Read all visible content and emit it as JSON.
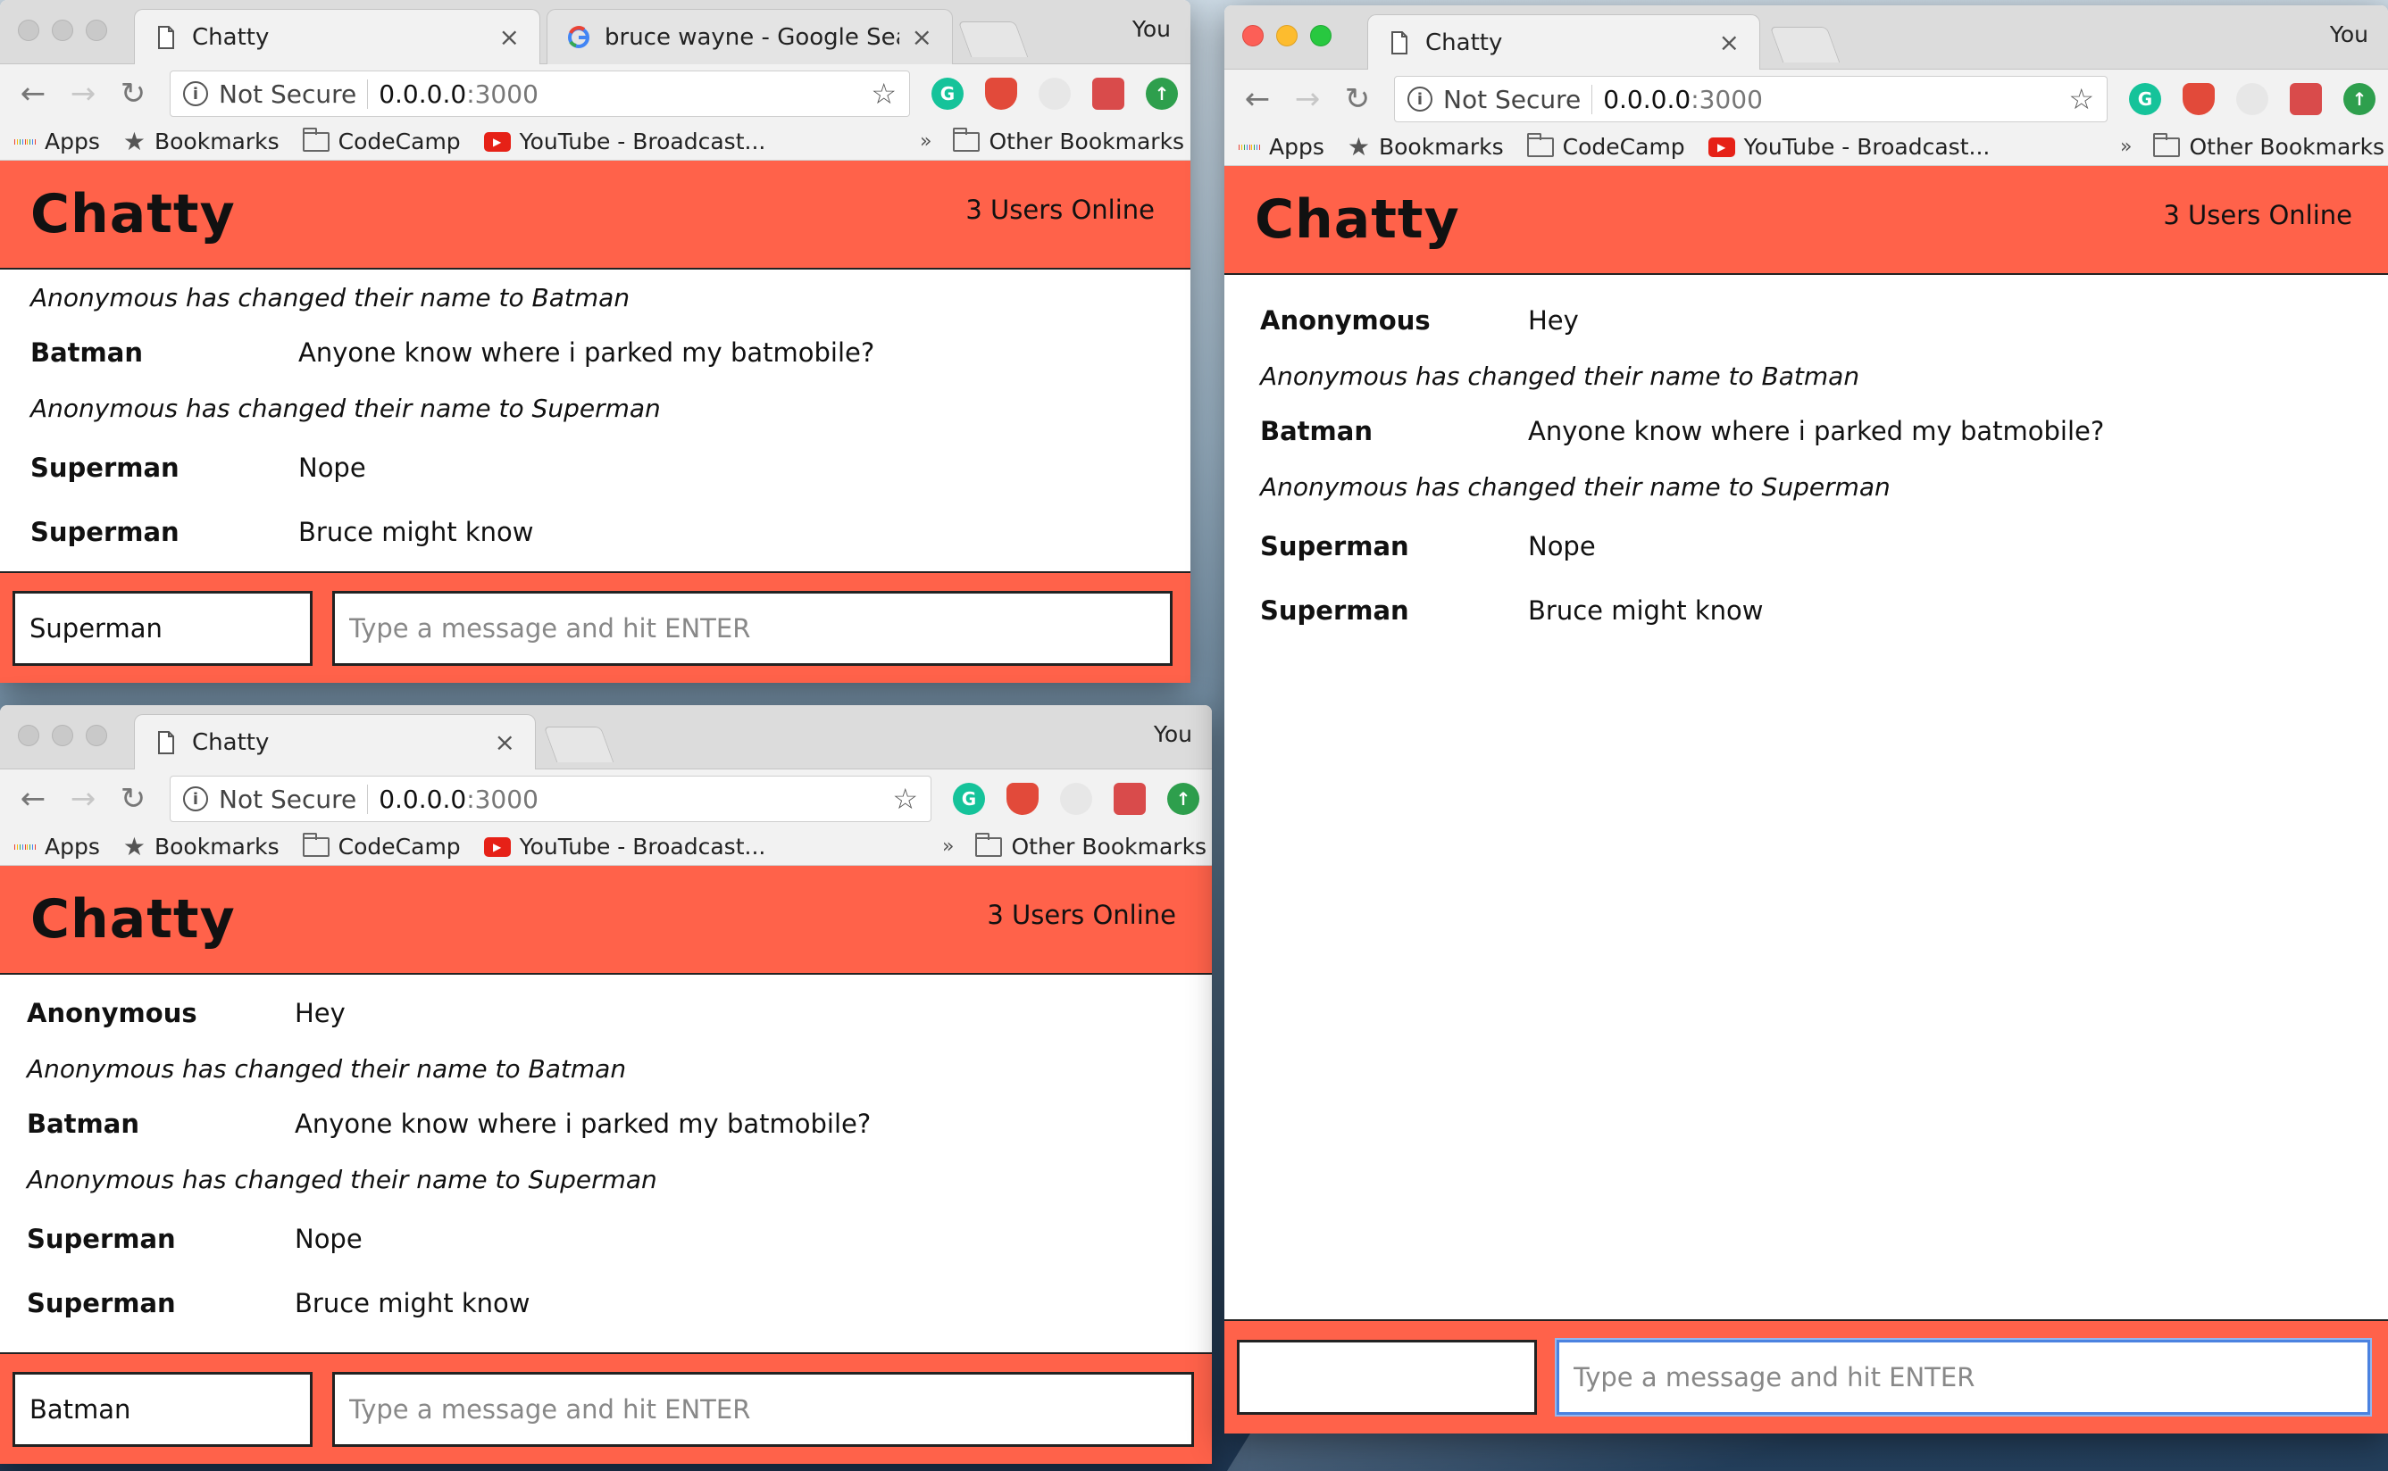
{
  "browser": {
    "profile": "You",
    "tab_active_title": "Chatty",
    "tab_google_title": "bruce wayne - Google Search",
    "tab_close": "×",
    "not_secure": "Not Secure",
    "url_host": "0.0.0.0",
    "url_port": ":3000",
    "bookmarks": {
      "apps": "Apps",
      "bookmarks": "Bookmarks",
      "codecamp": "CodeCamp",
      "youtube": "YouTube - Broadcast...",
      "more": "»",
      "other": "Other Bookmarks"
    }
  },
  "app": {
    "title": "Chatty",
    "users_online": "3 Users Online",
    "message_placeholder": "Type a message and hit ENTER"
  },
  "windows": {
    "left_top": {
      "current_user": "Superman",
      "messages": [
        {
          "type": "system",
          "content": "Anonymous has changed their name to Batman"
        },
        {
          "type": "message",
          "user": "Batman",
          "content": "Anyone know where i parked my batmobile?"
        },
        {
          "type": "system",
          "content": "Anonymous has changed their name to Superman"
        },
        {
          "type": "message",
          "user": "Superman",
          "content": "Nope"
        },
        {
          "type": "message",
          "user": "Superman",
          "content": "Bruce might know"
        }
      ]
    },
    "left_bottom": {
      "current_user": "Batman",
      "messages": [
        {
          "type": "message",
          "user": "Anonymous",
          "content": "Hey"
        },
        {
          "type": "system",
          "content": "Anonymous has changed their name to Batman"
        },
        {
          "type": "message",
          "user": "Batman",
          "content": "Anyone know where i parked my batmobile?"
        },
        {
          "type": "system",
          "content": "Anonymous has changed their name to Superman"
        },
        {
          "type": "message",
          "user": "Superman",
          "content": "Nope"
        },
        {
          "type": "message",
          "user": "Superman",
          "content": "Bruce might know"
        }
      ]
    },
    "right": {
      "current_user": "",
      "messages": [
        {
          "type": "message",
          "user": "Anonymous",
          "content": "Hey"
        },
        {
          "type": "system",
          "content": "Anonymous has changed their name to Batman"
        },
        {
          "type": "message",
          "user": "Batman",
          "content": "Anyone know where i parked my batmobile?"
        },
        {
          "type": "system",
          "content": "Anonymous has changed their name to Superman"
        },
        {
          "type": "message",
          "user": "Superman",
          "content": "Nope"
        },
        {
          "type": "message",
          "user": "Superman",
          "content": "Bruce might know"
        }
      ]
    }
  },
  "colors": {
    "app_accent": "#ff624a",
    "focus_ring": "#4b82e0"
  }
}
